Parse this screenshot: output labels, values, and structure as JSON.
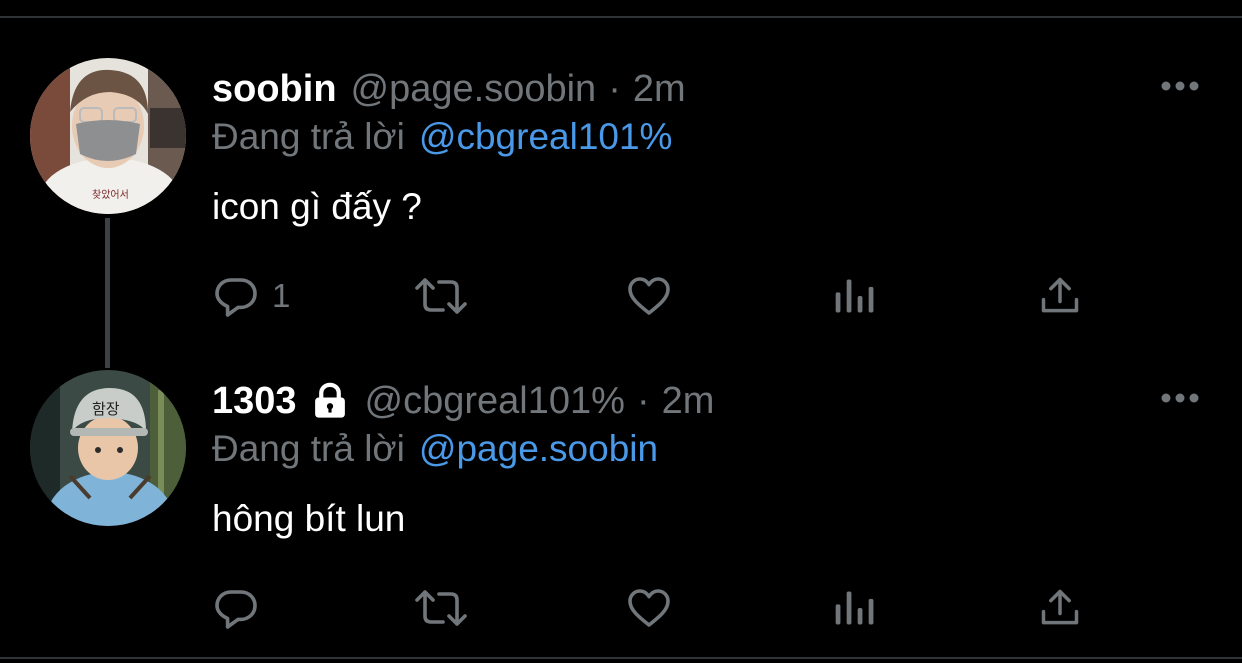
{
  "colors": {
    "background": "#000000",
    "text_primary": "#ffffff",
    "text_secondary": "#71767b",
    "mention": "#4a99e9",
    "divider": "#2f3336"
  },
  "tweets": [
    {
      "display_name": "soobin",
      "handle": "@page.soobin",
      "separator": "·",
      "time_ago": "2m",
      "reply_prefix": "Đang trả lời",
      "reply_to": "@cbgreal101%",
      "text": "icon gì đấy ?",
      "reply_count": "1",
      "locked": false,
      "icons": [
        "reply-icon",
        "retweet-icon",
        "like-icon",
        "views-icon",
        "share-icon",
        "more-icon"
      ]
    },
    {
      "display_name": "1303",
      "handle": "@cbgreal101%",
      "separator": "·",
      "time_ago": "2m",
      "reply_prefix": "Đang trả lời",
      "reply_to": "@page.soobin",
      "text": "hông bít lun",
      "reply_count": "",
      "locked": true,
      "icons": [
        "lock-icon",
        "reply-icon",
        "retweet-icon",
        "like-icon",
        "views-icon",
        "share-icon",
        "more-icon"
      ]
    }
  ]
}
